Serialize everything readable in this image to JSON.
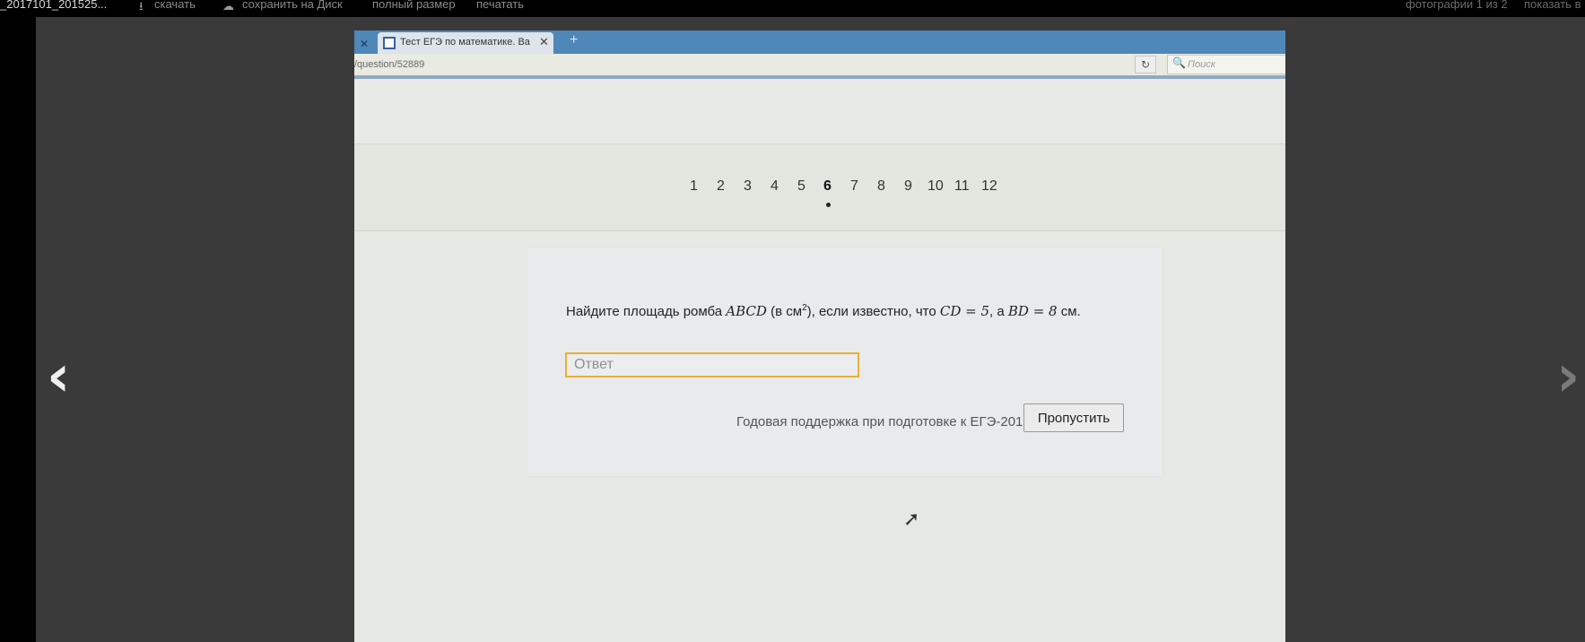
{
  "viewer_toolbar": {
    "filename": "_2017101_201525...",
    "download_label": "скачать",
    "save_to_disk_label": "сохранить на Диск",
    "full_size_label": "полный размер",
    "print_label": "печатать",
    "photo_counter": "фотографии 1 из 2",
    "show_all_label": "показать в"
  },
  "browser": {
    "tab_title": "Тест ЕГЭ по математике. Ва",
    "url": "/question/52889",
    "search_placeholder": "Поиск"
  },
  "question_nav": {
    "numbers": [
      "1",
      "2",
      "3",
      "4",
      "5",
      "6",
      "7",
      "8",
      "9",
      "10",
      "11",
      "12"
    ],
    "active": "6"
  },
  "question": {
    "text_1": "Найдите площадь ромба ",
    "math_1": "ABCD",
    "text_2": " (в см",
    "sup": "2",
    "text_3": "), если известно, что ",
    "math_2": "CD = 5",
    "text_4": ", а ",
    "math_3": "BD = 8",
    "text_5": " см."
  },
  "answer": {
    "placeholder": "Ответ"
  },
  "footer": {
    "promo_text": "Годовая поддержка при подготовке к ЕГЭ-2018",
    "skip_label": "Пропустить"
  },
  "icons": {
    "prev": "chevron-left-icon",
    "next": "chevron-right-icon",
    "download": "download-icon",
    "cloud": "cloud-icon",
    "search": "search-icon",
    "reload": "reload-icon",
    "cursor": "mouse-cursor-icon"
  }
}
